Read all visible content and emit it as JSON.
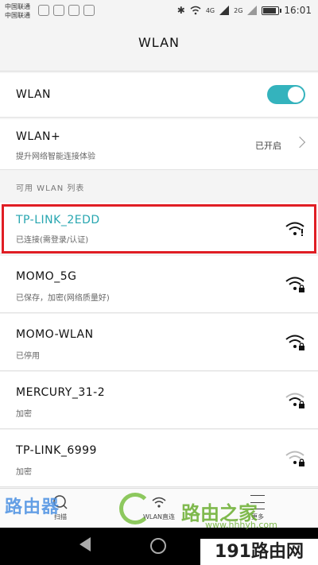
{
  "status_bar": {
    "carrier_1": "中国联通",
    "carrier_2": "中国联通",
    "net_4g": "4G",
    "net_2g": "2G",
    "time": "16:01",
    "battery_level": 0.8
  },
  "header": {
    "title": "WLAN"
  },
  "settings": {
    "wlan_label": "WLAN",
    "wlan_enabled": true,
    "wlan_plus_label": "WLAN+",
    "wlan_plus_desc": "提升网络智能连接体验",
    "wlan_plus_state": "已开启"
  },
  "section_header": "可用 WLAN 列表",
  "networks": [
    {
      "ssid": "TP-LINK_2EDD",
      "status": "已连接(需登录/认证)",
      "locked": false,
      "highlighted": true
    },
    {
      "ssid": "MOMO_5G",
      "status": "已保存，加密(网络质量好)",
      "locked": true
    },
    {
      "ssid": "MOMO-WLAN",
      "status": "已停用",
      "locked": true
    },
    {
      "ssid": "MERCURY_31-2",
      "status": "加密",
      "locked": true
    },
    {
      "ssid": "TP-LINK_6999",
      "status": "加密",
      "locked": true
    }
  ],
  "toolbar": {
    "scan_label": "扫描",
    "direct_label": "WLAN直连",
    "more_label": "更多"
  },
  "watermarks": {
    "left": "路由器",
    "center_title": "路由之家",
    "center_url": "www.hhhyh.com",
    "right": "191路由网"
  },
  "colors": {
    "accent": "#34b3bd",
    "connected_text": "#27a6b0",
    "highlight_border": "#e01e24"
  }
}
